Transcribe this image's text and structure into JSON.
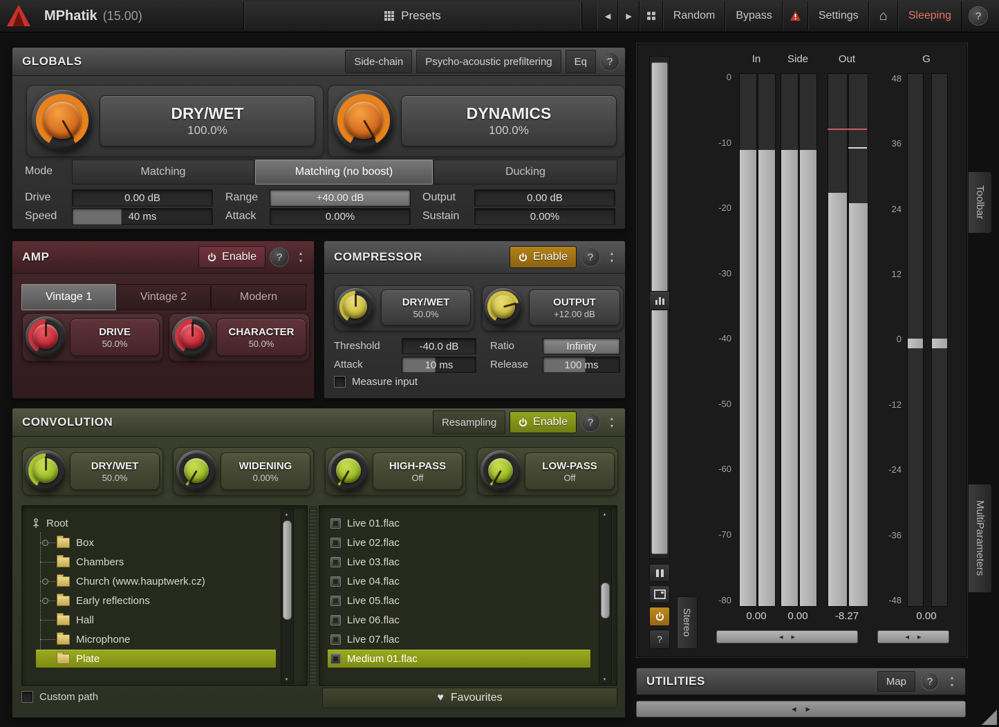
{
  "titlebar": {
    "title": "MPhatik",
    "version": "(15.00)",
    "presets_label": "Presets",
    "random_label": "Random",
    "bypass_label": "Bypass",
    "settings_label": "Settings",
    "sleeping_label": "Sleeping",
    "help_label": "?"
  },
  "icons": {
    "back": "◀",
    "forward": "▶",
    "up": "▴",
    "down": "▾",
    "home": "⌂",
    "heart": "♥",
    "left": "◂",
    "right": "▸"
  },
  "globals": {
    "title": "GLOBALS",
    "header_buttons": [
      "Side-chain",
      "Psycho-acoustic prefiltering",
      "Eq"
    ],
    "help_label": "?",
    "knobs": [
      {
        "label": "DRY/WET",
        "value": "100.0%"
      },
      {
        "label": "DYNAMICS",
        "value": "100.0%"
      }
    ],
    "mode": {
      "label": "Mode",
      "options": [
        "Matching",
        "Matching (no boost)",
        "Ducking"
      ],
      "selected": "Matching (no boost)"
    },
    "params": [
      {
        "label": "Drive",
        "value": "0.00 dB"
      },
      {
        "label": "Range",
        "value": "+40.00 dB"
      },
      {
        "label": "Output",
        "value": "0.00 dB"
      },
      {
        "label": "Speed",
        "value": "40 ms"
      },
      {
        "label": "Attack",
        "value": "0.00%"
      },
      {
        "label": "Sustain",
        "value": "0.00%"
      }
    ]
  },
  "amp": {
    "title": "AMP",
    "enable_label": "Enable",
    "help_label": "?",
    "tabs": [
      "Vintage 1",
      "Vintage 2",
      "Modern"
    ],
    "selected_tab": "Vintage 1",
    "knobs": [
      {
        "label": "DRIVE",
        "value": "50.0%"
      },
      {
        "label": "CHARACTER",
        "value": "50.0%"
      }
    ]
  },
  "compressor": {
    "title": "COMPRESSOR",
    "enable_label": "Enable",
    "help_label": "?",
    "knobs": [
      {
        "label": "DRY/WET",
        "value": "50.0%"
      },
      {
        "label": "OUTPUT",
        "value": "+12.00 dB"
      }
    ],
    "params": [
      {
        "label": "Threshold",
        "value": "-40.0 dB"
      },
      {
        "label": "Ratio",
        "value": "Infinity"
      },
      {
        "label": "Attack",
        "value": "10 ms"
      },
      {
        "label": "Release",
        "value": "100 ms"
      }
    ],
    "measure_input_label": "Measure input"
  },
  "convolution": {
    "title": "CONVOLUTION",
    "resampling_label": "Resampling",
    "enable_label": "Enable",
    "help_label": "?",
    "knobs": [
      {
        "label": "DRY/WET",
        "value": "50.0%"
      },
      {
        "label": "WIDENING",
        "value": "0.00%"
      },
      {
        "label": "HIGH-PASS",
        "value": "Off"
      },
      {
        "label": "LOW-PASS",
        "value": "Off"
      }
    ],
    "tree": {
      "root": "Root",
      "items": [
        "Box",
        "Chambers",
        "Church (www.hauptwerk.cz)",
        "Early reflections",
        "Hall",
        "Microphone",
        "Plate"
      ],
      "selected": "Plate"
    },
    "files": {
      "items": [
        "Live 01.flac",
        "Live 02.flac",
        "Live 03.flac",
        "Live 04.flac",
        "Live 05.flac",
        "Live 06.flac",
        "Live 07.flac",
        "Medium 01.flac"
      ],
      "selected": "Medium 01.flac"
    },
    "custom_path_label": "Custom path",
    "favourites_label": "Favourites"
  },
  "meters": {
    "headers": [
      "In",
      "Side",
      "Out",
      "G"
    ],
    "db_scale": [
      "0",
      "-10",
      "-20",
      "-30",
      "-40",
      "-50",
      "-60",
      "-70",
      "-80"
    ],
    "gain_scale": [
      "48",
      "36",
      "24",
      "12",
      "0",
      "-12",
      "-24",
      "-36",
      "-48"
    ],
    "readouts": [
      "0.00",
      "0.00",
      "-8.27",
      "0.00"
    ],
    "stereo_label": "Stereo"
  },
  "side_tabs": {
    "toolbar": "Toolbar",
    "multiparameters": "MultiParameters"
  },
  "utilities": {
    "title": "UTILITIES",
    "map_label": "Map",
    "help_label": "?"
  }
}
